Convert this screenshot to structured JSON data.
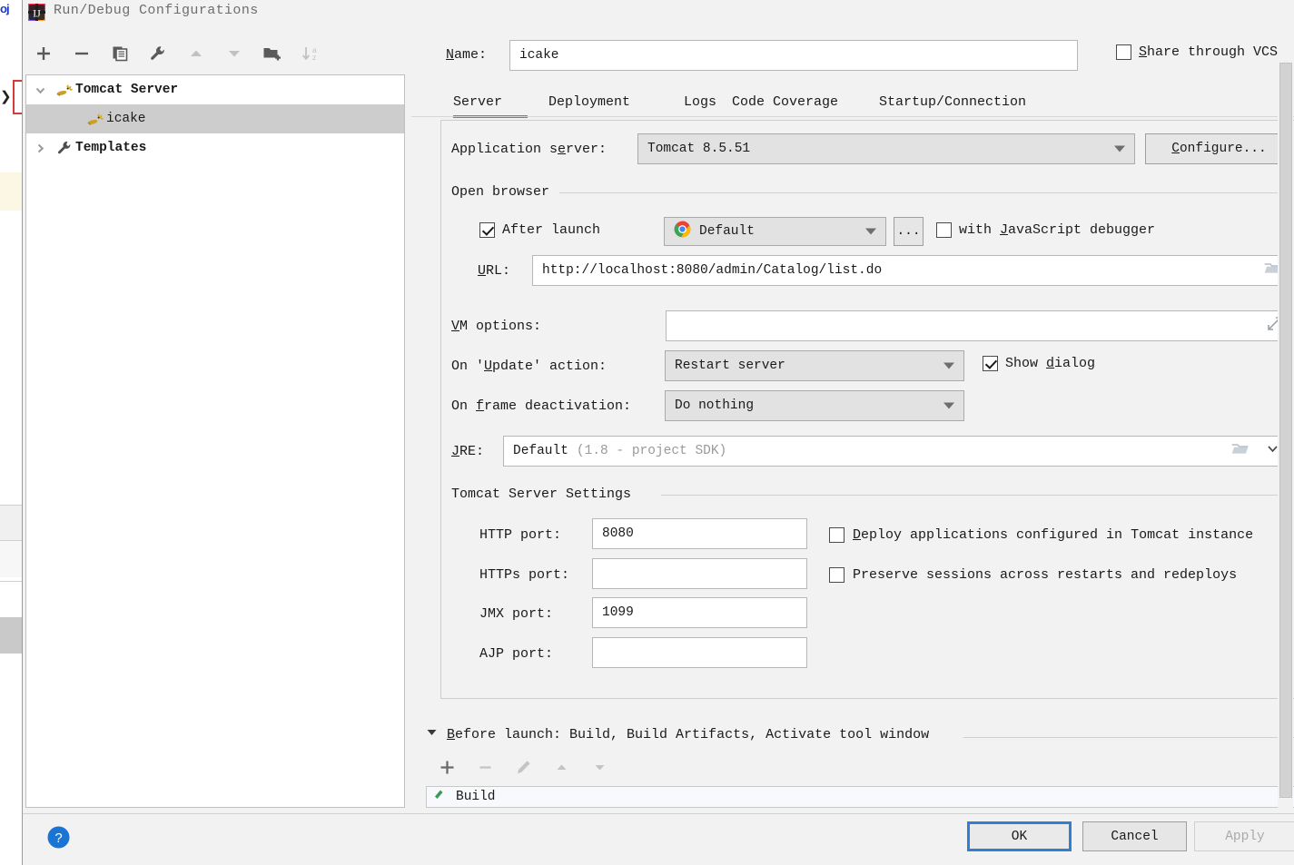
{
  "window": {
    "title": "Run/Debug Configurations",
    "app_icon": "intellij-idea-icon"
  },
  "left_panel": {
    "toolbar": [
      {
        "name": "add-configuration-button",
        "icon": "plus-icon",
        "glyph": "+",
        "enabled": true
      },
      {
        "name": "remove-configuration-button",
        "icon": "minus-icon",
        "glyph": "−",
        "enabled": true
      },
      {
        "name": "copy-configuration-button",
        "icon": "copy-icon",
        "glyph": "copy",
        "enabled": true
      },
      {
        "name": "edit-templates-button",
        "icon": "wrench-icon",
        "glyph": "wrench",
        "enabled": true
      },
      {
        "name": "move-up-button",
        "icon": "arrow-up-icon",
        "glyph": "▲",
        "enabled": false
      },
      {
        "name": "move-down-button",
        "icon": "arrow-down-icon",
        "glyph": "▼",
        "enabled": false
      },
      {
        "name": "create-folder-button",
        "icon": "folder-add-icon",
        "glyph": "folder+",
        "enabled": true
      },
      {
        "name": "sort-configurations-button",
        "icon": "sort-alpha-icon",
        "glyph": "sort-az",
        "enabled": false
      }
    ],
    "tree": [
      {
        "label": "Tomcat Server",
        "icon": "tomcat-icon",
        "toggle": "chevron-down-icon",
        "level": 0,
        "selected": false,
        "bold": true
      },
      {
        "label": "icake",
        "icon": "tomcat-icon",
        "toggle": "",
        "level": 1,
        "selected": true,
        "bold": false
      },
      {
        "label": "Templates",
        "icon": "wrench-icon",
        "toggle": "chevron-right-icon",
        "level": 0,
        "selected": false,
        "bold": true
      }
    ]
  },
  "name_row": {
    "label": "Name:",
    "value": "icake",
    "placeholder": "",
    "share_checkbox": {
      "label": "Share through VCS",
      "checked": false
    },
    "help_icon": "help-circle-icon"
  },
  "tabs": {
    "items": [
      {
        "label": "Server",
        "selected": true
      },
      {
        "label": "Deployment",
        "selected": false
      },
      {
        "label": "Logs",
        "selected": false
      },
      {
        "label": "Code Coverage",
        "selected": false
      },
      {
        "label": "Startup/Connection",
        "selected": false
      }
    ],
    "accent_color": "#4a88c7"
  },
  "server_tab": {
    "application_server": {
      "label": "Application server:",
      "value": "Tomcat 8.5.51",
      "configure_button": "Configure..."
    },
    "open_browser": {
      "group_label": "Open browser",
      "after_launch": {
        "label": "After launch",
        "checked": true
      },
      "browser": {
        "value": "Default",
        "icon": "chrome-icon"
      },
      "browse_button": "...",
      "js_debugger": {
        "label": "with JavaScript debugger",
        "checked": false
      },
      "url": {
        "label": "URL:",
        "value": "http://localhost:8080/admin/Catalog/list.do",
        "browse_icon": "folder-icon"
      }
    },
    "vm_options": {
      "label": "VM options:",
      "value": "",
      "expand_icon": "expand-diagonal-icon"
    },
    "on_update_action": {
      "label": "On 'Update' action:",
      "value": "Restart server"
    },
    "show_dialog": {
      "label": "Show dialog",
      "checked": true
    },
    "on_frame_deactivation": {
      "label": "On frame deactivation:",
      "value": "Do nothing"
    },
    "jre": {
      "label": "JRE:",
      "value": "Default",
      "hint": "(1.8 - project SDK)",
      "browse_icon": "folder-icon",
      "dropdown_icon": "chevron-down-icon"
    },
    "tomcat_settings": {
      "group_label": "Tomcat Server Settings",
      "ports": [
        {
          "label": "HTTP port:",
          "value": "8080",
          "name": "http-port-field"
        },
        {
          "label": "HTTPs port:",
          "value": "",
          "name": "https-port-field"
        },
        {
          "label": "JMX port:",
          "value": "1099",
          "name": "jmx-port-field"
        },
        {
          "label": "AJP port:",
          "value": "",
          "name": "ajp-port-field"
        }
      ],
      "checkboxes": [
        {
          "label": "Deploy applications configured in Tomcat instance",
          "checked": false,
          "name": "deploy-applications-checkbox"
        },
        {
          "label": "Preserve sessions across restarts and redeploys",
          "checked": false,
          "name": "preserve-sessions-checkbox"
        }
      ]
    }
  },
  "before_launch": {
    "header": "Before launch: Build, Build Artifacts, Activate tool window",
    "toggle_icon": "chevron-down-icon",
    "toolbar": [
      {
        "name": "add-task-button",
        "icon": "plus-icon",
        "glyph": "+",
        "enabled": true
      },
      {
        "name": "remove-task-button",
        "icon": "minus-icon",
        "glyph": "−",
        "enabled": false
      },
      {
        "name": "edit-task-button",
        "icon": "pencil-icon",
        "glyph": "pencil",
        "enabled": false
      },
      {
        "name": "task-move-up-button",
        "icon": "arrow-up-icon",
        "glyph": "▲",
        "enabled": false
      },
      {
        "name": "task-move-down-button",
        "icon": "arrow-down-icon",
        "glyph": "▼",
        "enabled": false
      }
    ],
    "tasks": [
      {
        "label": "Build",
        "icon": "build-hammer-icon"
      }
    ]
  },
  "footer": {
    "help_icon": "help-circle-icon",
    "ok_label": "OK",
    "cancel_label": "Cancel",
    "apply_label": "Apply",
    "apply_enabled": false,
    "focus_color": "#2f7fd4"
  }
}
